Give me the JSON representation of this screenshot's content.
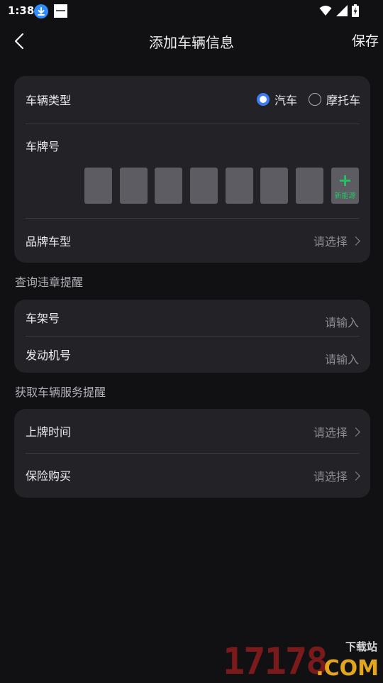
{
  "status_bar": {
    "time": "1:38",
    "icons": [
      "download-icon",
      "app-icon",
      "wifi-icon",
      "signal-icon",
      "battery-charging-icon"
    ],
    "colors": {
      "download": "#2f8cff"
    }
  },
  "header": {
    "title": "添加车辆信息",
    "save_label": "保存"
  },
  "vehicle_card": {
    "type_label": "车辆类型",
    "type_options": [
      {
        "label": "汽车",
        "selected": true
      },
      {
        "label": "摩托车",
        "selected": false
      }
    ],
    "plate_label": "车牌号",
    "plate_slots": 7,
    "new_energy_label": "新能源",
    "brand_label": "品牌车型",
    "brand_placeholder": "请选择"
  },
  "violation_section": {
    "title": "查询违章提醒",
    "rows": [
      {
        "label": "车架号",
        "placeholder": "请输入"
      },
      {
        "label": "发动机号",
        "placeholder": "请输入"
      }
    ]
  },
  "service_section": {
    "title": "获取车辆服务提醒",
    "rows": [
      {
        "label": "上牌时间",
        "placeholder": "请选择"
      },
      {
        "label": "保险购买",
        "placeholder": "请选择"
      }
    ]
  },
  "watermark": {
    "number": "17178",
    "cn_text": "下载站",
    "domain": ".COM"
  },
  "colors": {
    "background": "#111114",
    "card": "#232327",
    "accent_blue": "#3a7bf6",
    "accent_green": "#27c265",
    "plate_slot": "#5c5c62"
  }
}
